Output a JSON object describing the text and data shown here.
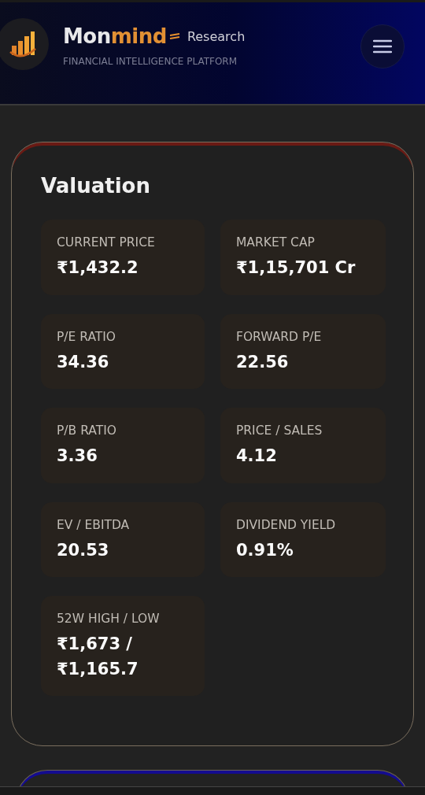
{
  "header": {
    "brand_first": "Mon",
    "brand_second": "mind",
    "brand_suffix": "Research",
    "tagline": "FINANCIAL INTELLIGENCE PLATFORM"
  },
  "valuation": {
    "title": "Valuation",
    "metrics": [
      {
        "label": "CURRENT PRICE",
        "value": "₹1,432.2"
      },
      {
        "label": "MARKET CAP",
        "value": "₹1,15,701 Cr"
      },
      {
        "label": "P/E RATIO",
        "value": "34.36"
      },
      {
        "label": "FORWARD P/E",
        "value": "22.56"
      },
      {
        "label": "P/B RATIO",
        "value": "3.36"
      },
      {
        "label": "PRICE / SALES",
        "value": "4.12"
      },
      {
        "label": "EV / EBITDA",
        "value": "20.53"
      },
      {
        "label": "DIVIDEND YIELD",
        "value": "0.91%"
      },
      {
        "label": "52W HIGH / LOW",
        "value": "₹1,673 / ₹1,165.7"
      }
    ]
  }
}
